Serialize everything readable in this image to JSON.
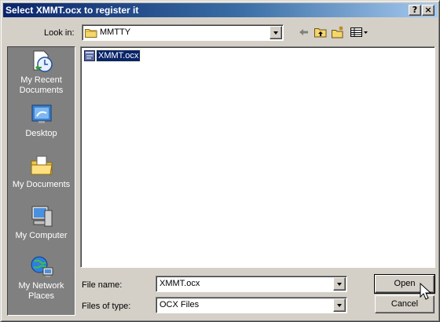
{
  "dialog": {
    "title": "Select XMMT.ocx to register it",
    "help_glyph": "?",
    "close_glyph": "×"
  },
  "lookin": {
    "label": "Look in:",
    "value": "MMTTY"
  },
  "toolbar": {
    "icons": [
      "back-arrow-icon",
      "up-one-level-icon",
      "new-folder-icon",
      "view-menu-icon"
    ]
  },
  "places": [
    {
      "id": "recent",
      "label": "My Recent Documents",
      "icon": "recent-documents-icon"
    },
    {
      "id": "desktop",
      "label": "Desktop",
      "icon": "desktop-icon"
    },
    {
      "id": "documents",
      "label": "My Documents",
      "icon": "my-documents-icon"
    },
    {
      "id": "computer",
      "label": "My Computer",
      "icon": "my-computer-icon"
    },
    {
      "id": "network",
      "label": "My Network Places",
      "icon": "network-places-icon"
    }
  ],
  "files": [
    {
      "name": "XMMT.ocx",
      "selected": true,
      "icon": "ocx-file-icon"
    }
  ],
  "form": {
    "filename_label": "File name:",
    "filename_value": "XMMT.ocx",
    "filetype_label": "Files of type:",
    "filetype_value": "OCX Files"
  },
  "buttons": {
    "open": "Open",
    "cancel": "Cancel"
  },
  "colors": {
    "title_start": "#0a246a",
    "title_end": "#a6caf0",
    "face": "#d4d0c8",
    "places_bar": "#808080",
    "selection": "#0a246a"
  }
}
